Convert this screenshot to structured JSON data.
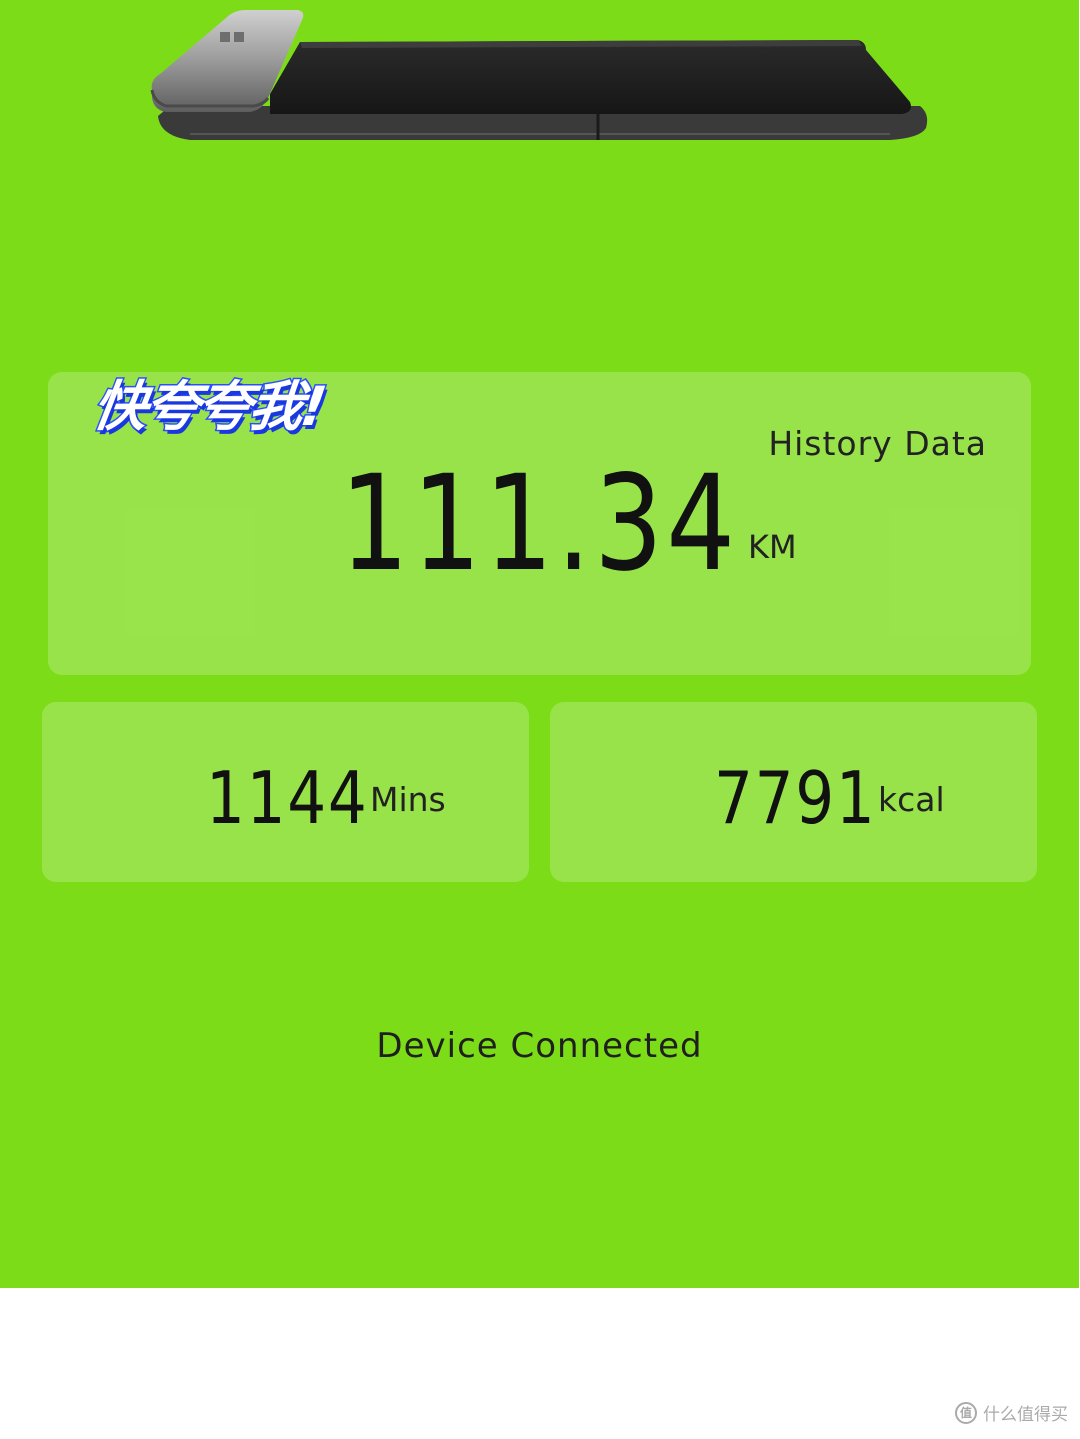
{
  "header": {
    "sticker_text": "快夸夸我!"
  },
  "history": {
    "label": "History Data",
    "distance_value": "111.34",
    "distance_unit": "KM"
  },
  "stats": {
    "minutes_value": "1144",
    "minutes_unit": "Mins",
    "calories_value": "7791",
    "calories_unit": "kcal"
  },
  "status": {
    "text": "Device Connected"
  },
  "watermark": {
    "icon": "zhi-icon",
    "text": "什么值得买"
  },
  "colors": {
    "background": "#7ddc18",
    "card_overlay": "rgba(255,255,255,0.22)",
    "sticker_outline": "#2b4fff"
  }
}
